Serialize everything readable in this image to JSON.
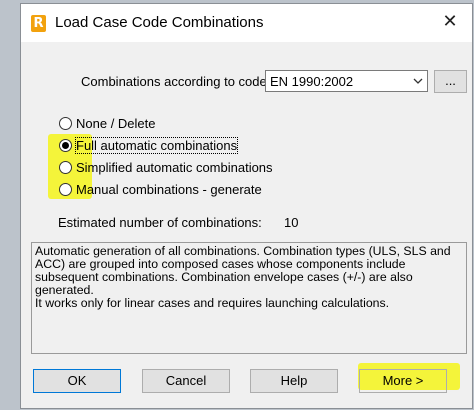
{
  "window": {
    "title": "Load Case Code Combinations",
    "close_glyph": "✕",
    "app_icon_letter": "R",
    "app_icon_color": "#f2a20e"
  },
  "code": {
    "label": "Combinations according to code:",
    "selected": "EN 1990:2002",
    "browse_label": "..."
  },
  "options": [
    {
      "label": "None / Delete",
      "checked": false
    },
    {
      "label": "Full automatic combinations",
      "checked": true
    },
    {
      "label": "Simplified automatic combinations",
      "checked": false
    },
    {
      "label": "Manual combinations - generate",
      "checked": false
    }
  ],
  "estimate": {
    "label": "Estimated number of combinations:",
    "value": "10"
  },
  "description": "Automatic generation of all combinations. Combination types (ULS, SLS and ACC) are grouped into composed cases whose components include subsequent combinations. Combination envelope cases (+/-) are also generated.\nIt works only for linear cases and requires launching calculations.",
  "buttons": {
    "ok": "OK",
    "cancel": "Cancel",
    "help": "Help",
    "more": "More >"
  },
  "highlight_color": "#f4f41a"
}
